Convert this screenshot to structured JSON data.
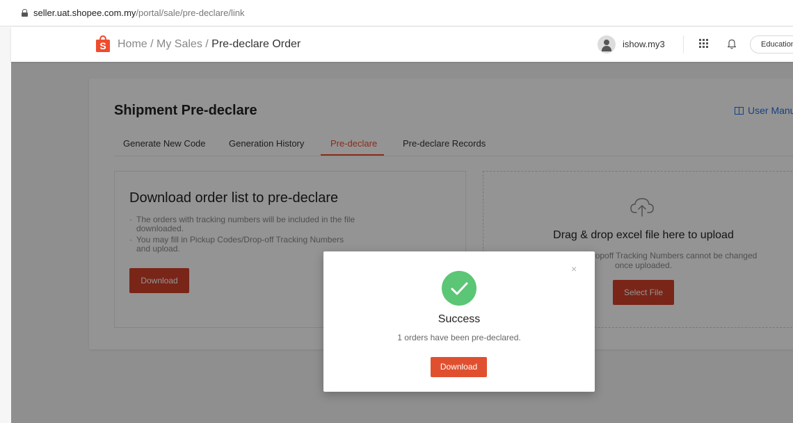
{
  "browser": {
    "url_domain": "seller.uat.shopee.com.my",
    "url_path": "/portal/sale/pre-declare/link"
  },
  "header": {
    "breadcrumb": {
      "home": "Home",
      "separator": " / ",
      "section": "My Sales",
      "current": "Pre-declare Order"
    },
    "username": "ishow.my3",
    "education_label": "Education",
    "icons": [
      "shopee-logo-icon",
      "avatar-icon",
      "apps-grid-icon",
      "bell-icon"
    ]
  },
  "page": {
    "title": "Shipment Pre-declare",
    "user_manual": "User Manu",
    "tabs": [
      {
        "label": "Generate New Code",
        "active": false
      },
      {
        "label": "Generation History",
        "active": false
      },
      {
        "label": "Pre-declare",
        "active": true
      },
      {
        "label": "Pre-declare Records",
        "active": false
      }
    ],
    "download_section": {
      "title": "Download order list to pre-declare",
      "bullets": [
        "The orders with tracking numbers will be included in the file downloaded.",
        "You may fill in Pickup Codes/Drop-off Tracking Numbers and upload."
      ],
      "button": "Download"
    },
    "upload_section": {
      "title": "Drag & drop excel file here to upload",
      "note_line1": "ropoff Tracking Numbers cannot be changed",
      "note_line2": "once uploaded.",
      "button": "Select File"
    }
  },
  "modal": {
    "title": "Success",
    "message": "1 orders have been pre-declared.",
    "button": "Download",
    "close": "×"
  },
  "colors": {
    "brand_orange": "#ee4d2d",
    "button_red": "#d0412a",
    "success_green": "#5bc675",
    "link_blue": "#2673dd"
  }
}
